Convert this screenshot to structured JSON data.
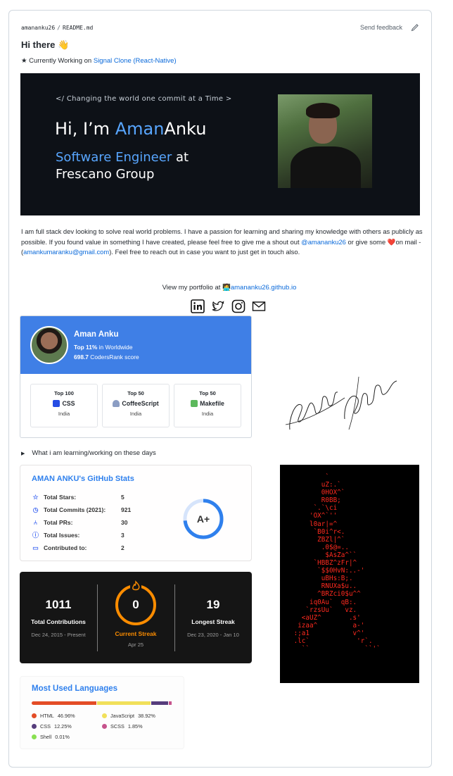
{
  "header": {
    "owner": "amananku26",
    "separator": "/",
    "file": "README.md",
    "feedback": "Send feedback"
  },
  "greeting": "Hi there 👋",
  "working": {
    "prefix": "★ Currently Working on ",
    "project": "Signal Clone (React-Native)"
  },
  "banner": {
    "quote": "</ Changing the world one commit at a Time >",
    "hi": "Hi, I’m ",
    "first": "Aman",
    "last": "Anku",
    "role_blue": "Software Engineer",
    "role_rest": " at",
    "company": "Frescano Group"
  },
  "about": {
    "p1": "I am full stack dev looking to solve real world problems. I have a passion for learning and sharing my knowledge with others as publicly as possible. If you found value in something I have created, please feel free to give me a shout out ",
    "handle": "@amananku26",
    "p2": " or give some ",
    "heart": "❤️",
    "p3": "on mail - (",
    "email": "amankumaranku@gmail.com",
    "p4": "). Feel free to reach out in case you want to just get in touch also."
  },
  "portfolio": {
    "prefix": "View my portfolio at ",
    "emoji": "🧑‍💻",
    "site": "amananku26.github.io"
  },
  "socials": [
    "linkedin-icon",
    "twitter-icon",
    "instagram-icon",
    "mail-icon"
  ],
  "codersrank": {
    "name": "Aman Anku",
    "rank_bold": "Top 11%",
    "rank_rest": " in Worldwide",
    "score_bold": "698.7",
    "score_rest": " CodersRank score",
    "tiles": [
      {
        "top": "Top 100",
        "lang": "CSS",
        "region": "India",
        "color": "#264de4"
      },
      {
        "top": "Top 50",
        "lang": "CoffeeScript",
        "region": "India",
        "color": "#6f4e37"
      },
      {
        "top": "Top 50",
        "lang": "Makefile",
        "region": "India",
        "color": "#5cb85c"
      }
    ]
  },
  "summary": "What i am learning/working on these days",
  "github_stats": {
    "title": "AMAN ANKU's GitHub Stats",
    "rows": [
      {
        "icon": "star-icon",
        "label": "Total Stars:",
        "value": "5"
      },
      {
        "icon": "history-icon",
        "label": "Total Commits (2021):",
        "value": "921"
      },
      {
        "icon": "pull-request-icon",
        "label": "Total PRs:",
        "value": "30"
      },
      {
        "icon": "issue-icon",
        "label": "Total Issues:",
        "value": "3"
      },
      {
        "icon": "repo-icon",
        "label": "Contributed to:",
        "value": "2"
      }
    ],
    "grade": "A+",
    "accent": "#2f80ed"
  },
  "streak": {
    "total": "1011",
    "total_label": "Total Contributions",
    "total_range": "Dec 24, 2015 - Present",
    "current": "0",
    "current_label": "Current Streak",
    "current_date": "Apr 25",
    "longest": "19",
    "longest_label": "Longest Streak",
    "longest_range": "Dec 23, 2020 - Jan 10",
    "accent": "#fb8c00"
  },
  "languages": {
    "title": "Most Used Languages",
    "items": [
      {
        "name": "HTML",
        "pct": "46.96%",
        "value": 46.96,
        "color": "#e34c26"
      },
      {
        "name": "JavaScript",
        "pct": "38.92%",
        "value": 38.92,
        "color": "#f1e05a"
      },
      {
        "name": "CSS",
        "pct": "12.25%",
        "value": 12.25,
        "color": "#563d7c"
      },
      {
        "name": "SCSS",
        "pct": "1.85%",
        "value": 1.85,
        "color": "#c6538c"
      },
      {
        "name": "Shell",
        "pct": "0.01%",
        "value": 0.01,
        "color": "#89e051"
      }
    ]
  },
  "ascii_art": "         `\n        uZ:.`\n        0HOX^`\n        R0BB;\n      `.`\\ci\n     'OX^`''\n     l0ar|=^\n      `B0i^r<.\n       ZBZl|^`\n        .0$@=..\n         $AsZa^``\n      `HBBZ^zFr|^\n       `$$0HvN:..-'\n        uBHs:B;.\n        RNUXa$u..\n       ^BRZci0$u^^\n     iq0Au`  qB:.\n    `rzsUu`   vz.\n   <aUZ^       .s'\n  izaa^         a-'\n :;a1           v^'\n .lc`            'r`.\n   ``              ``'`"
}
